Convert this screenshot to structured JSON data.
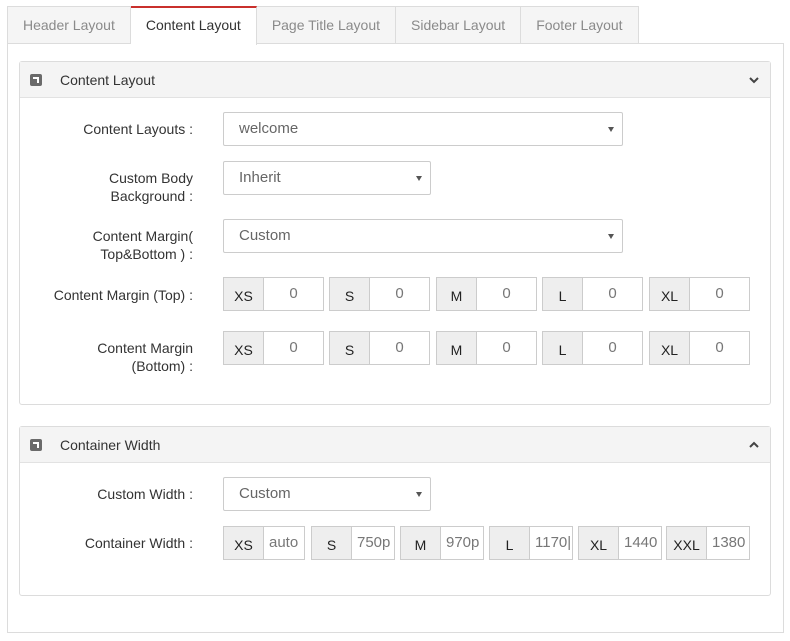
{
  "tabs": [
    {
      "label": "Header Layout"
    },
    {
      "label": "Content Layout"
    },
    {
      "label": "Page Title Layout"
    },
    {
      "label": "Sidebar Layout"
    },
    {
      "label": "Footer Layout"
    }
  ],
  "content_panel": {
    "title": "Content Layout",
    "content_layouts": {
      "label": "Content Layouts :",
      "value": "welcome"
    },
    "custom_body_background": {
      "label_line1": "Custom Body",
      "label_line2": "Background :",
      "value": "Inherit"
    },
    "content_margin": {
      "label_line1": "Content Margin(",
      "label_line2": "Top&Bottom ) :",
      "value": "Custom"
    },
    "content_margin_top": {
      "label": "Content Margin (Top) :",
      "fields": [
        {
          "addon": "XS",
          "value": "0"
        },
        {
          "addon": "S",
          "value": "0"
        },
        {
          "addon": "M",
          "value": "0"
        },
        {
          "addon": "L",
          "value": "0"
        },
        {
          "addon": "XL",
          "value": "0"
        }
      ]
    },
    "content_margin_bottom": {
      "label_line1": "Content Margin",
      "label_line2": "(Bottom) :",
      "fields": [
        {
          "addon": "XS",
          "value": "0"
        },
        {
          "addon": "S",
          "value": "0"
        },
        {
          "addon": "M",
          "value": "0"
        },
        {
          "addon": "L",
          "value": "0"
        },
        {
          "addon": "XL",
          "value": "0"
        }
      ]
    }
  },
  "container_panel": {
    "title": "Container Width",
    "custom_width": {
      "label": "Custom Width :",
      "value": "Custom"
    },
    "container_width": {
      "label": "Container Width :",
      "fields": [
        {
          "addon": "XS",
          "value": "auto"
        },
        {
          "addon": "S",
          "value": "750p"
        },
        {
          "addon": "M",
          "value": "970p"
        },
        {
          "addon": "L",
          "value": "1170|"
        },
        {
          "addon": "XL",
          "value": "1440"
        },
        {
          "addon": "XXL",
          "value": "1380"
        }
      ]
    }
  }
}
